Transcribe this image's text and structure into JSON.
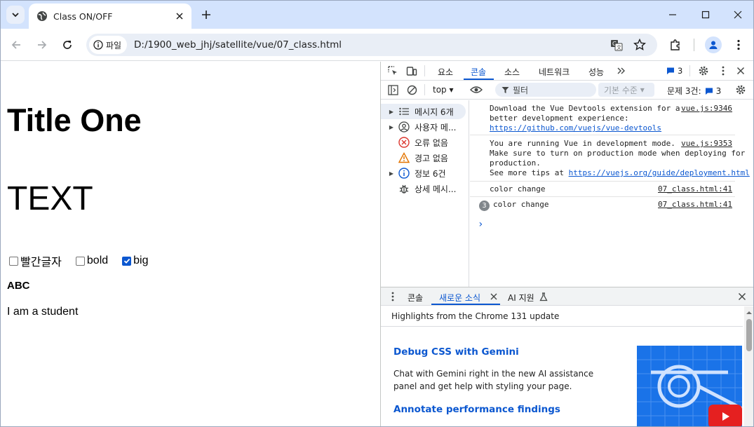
{
  "browser": {
    "tab_title": "Class ON/OFF",
    "site_chip": "파일",
    "url": "D:/1900_web_jhj/satellite/vue/07_class.html"
  },
  "page": {
    "title": "Title One",
    "text": "TEXT",
    "options": [
      {
        "label": "빨간글자",
        "checked": false
      },
      {
        "label": "bold",
        "checked": false
      },
      {
        "label": "big",
        "checked": true
      }
    ],
    "abc": "ABC",
    "student": "I am a student"
  },
  "devtools": {
    "tabs": [
      "요소",
      "콘솔",
      "소스",
      "네트워크",
      "성능"
    ],
    "active_tab": "콘솔",
    "issues_count": "3",
    "context": "top",
    "filter_placeholder": "필터",
    "levels": "기본 수준",
    "issues_label": "문제 3건:",
    "sidebar": [
      {
        "label": "메시지 6개",
        "icon": "list-icon",
        "expandable": true,
        "selected": true
      },
      {
        "label": "사용자 메...",
        "icon": "user-icon",
        "expandable": true,
        "selected": false
      },
      {
        "label": "오류 없음",
        "icon": "error-icon",
        "expandable": false,
        "selected": false
      },
      {
        "label": "경고 없음",
        "icon": "warning-icon",
        "expandable": false,
        "selected": false
      },
      {
        "label": "정보 6건",
        "icon": "info-icon",
        "expandable": true,
        "selected": false
      },
      {
        "label": "상세 메시...",
        "icon": "bug-icon",
        "expandable": false,
        "selected": false
      }
    ],
    "messages": {
      "m1_line1": "Download the Vue Devtools extension for a",
      "m1_line2": "better development experience:",
      "m1_link": "https://github.com/vuejs/vue-devtools",
      "m1_src": "vue.js:9346",
      "m2_line1": "You are running Vue in development mode.",
      "m2_line2": "Make sure to turn on production mode when deploying for",
      "m2_line3": "production.",
      "m2_line4": "See more tips at ",
      "m2_link": "https://vuejs.org/guide/deployment.html",
      "m2_src": "vue.js:9353",
      "m3_text": "color change",
      "m3_src": "07_class.html:41",
      "m4_count": "3",
      "m4_text": "color change",
      "m4_src": "07_class.html:41",
      "prompt": "›"
    },
    "drawer": {
      "tabs": [
        "콘솔",
        "새로운 소식",
        "AI 지원"
      ],
      "active_tab": "새로운 소식",
      "highlights": "Highlights from the Chrome 131 update",
      "card1_title": "Debug CSS with Gemini",
      "card1_body": "Chat with Gemini right in the new AI assistance panel and get help with styling your page.",
      "card2_title": "Annotate performance findings"
    }
  }
}
